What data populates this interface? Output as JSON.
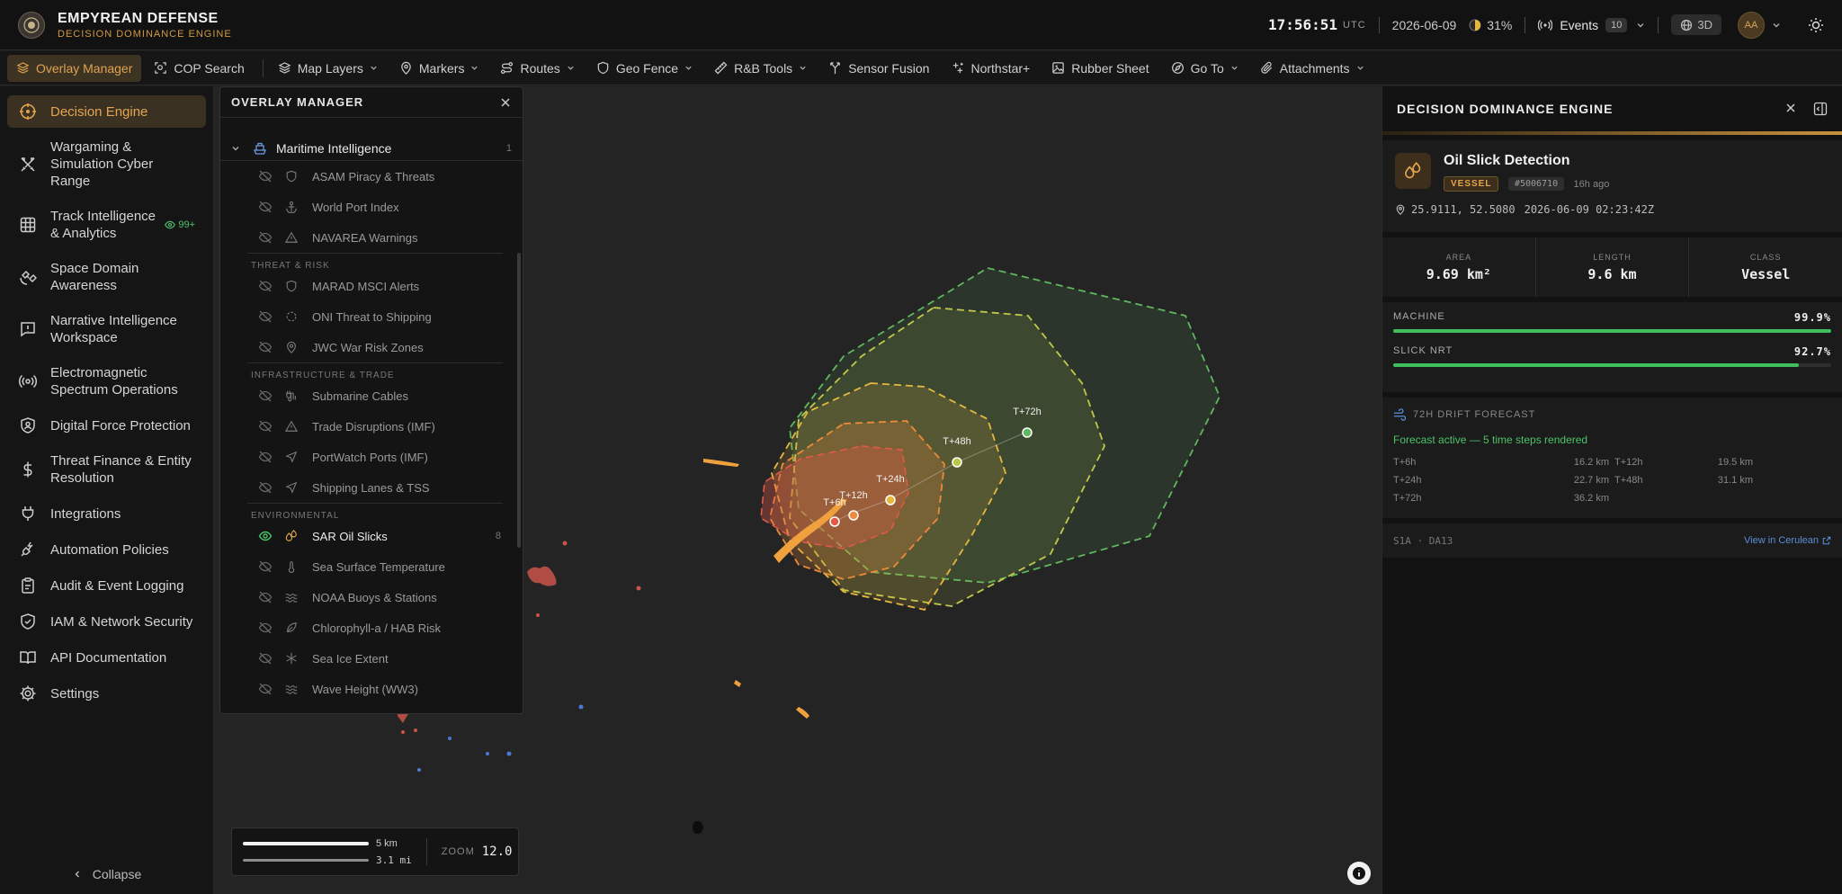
{
  "brand": {
    "title": "EMPYREAN DEFENSE",
    "subtitle": "DECISION DOMINANCE ENGINE"
  },
  "status": {
    "time": "17:56:51",
    "tz": "UTC",
    "date": "2026-06-09",
    "moon_pct": "31%",
    "events_label": "Events",
    "events_count": "10",
    "view_mode": "3D",
    "user_initials": "AA"
  },
  "toolbar": [
    {
      "label": "Overlay Manager",
      "icon": "layers-icon",
      "active": true
    },
    {
      "label": "COP Search",
      "icon": "scan-search-icon"
    },
    {
      "label": "Map Layers",
      "icon": "layers-icon",
      "chevron": true
    },
    {
      "label": "Markers",
      "icon": "map-pin-icon",
      "chevron": true
    },
    {
      "label": "Routes",
      "icon": "route-icon",
      "chevron": true
    },
    {
      "label": "Geo Fence",
      "icon": "shield-icon",
      "chevron": true
    },
    {
      "label": "R&B Tools",
      "icon": "ruler-icon",
      "chevron": true
    },
    {
      "label": "Sensor Fusion",
      "icon": "merge-icon"
    },
    {
      "label": "Northstar+",
      "icon": "sparkle-icon"
    },
    {
      "label": "Rubber Sheet",
      "icon": "image-icon"
    },
    {
      "label": "Go To",
      "icon": "compass-icon",
      "chevron": true
    },
    {
      "label": "Attachments",
      "icon": "paperclip-icon",
      "chevron": true
    }
  ],
  "sidebar": {
    "items": [
      {
        "label": "Decision Engine",
        "icon": "target-icon",
        "active": true
      },
      {
        "label": "Wargaming & Simulation Cyber Range",
        "icon": "swords-icon"
      },
      {
        "label": "Track Intelligence & Analytics",
        "icon": "grid-icon",
        "badge": "99+"
      },
      {
        "label": "Space Domain Awareness",
        "icon": "satellite-icon"
      },
      {
        "label": "Narrative Intelligence Workspace",
        "icon": "message-alert-icon"
      },
      {
        "label": "Electromagnetic Spectrum Operations",
        "icon": "radio-icon"
      },
      {
        "label": "Digital Force Protection",
        "icon": "shield-user-icon"
      },
      {
        "label": "Threat Finance & Entity Resolution",
        "icon": "dollar-icon"
      },
      {
        "label": "Integrations",
        "icon": "plug-icon"
      },
      {
        "label": "Automation Policies",
        "icon": "plug-zap-icon"
      },
      {
        "label": "Audit & Event Logging",
        "icon": "clipboard-icon"
      },
      {
        "label": "IAM & Network Security",
        "icon": "shield-check-icon"
      },
      {
        "label": "API Documentation",
        "icon": "book-icon"
      },
      {
        "label": "Settings",
        "icon": "gear-icon"
      }
    ],
    "collapse_label": "Collapse"
  },
  "overlay_manager": {
    "title": "OVERLAY MANAGER",
    "group": {
      "label": "Maritime Intelligence",
      "count": "1"
    },
    "rows_a": [
      {
        "label": "ASAM Piracy & Threats",
        "icon": "shield-icon"
      },
      {
        "label": "World Port Index",
        "icon": "anchor-icon"
      },
      {
        "label": "NAVAREA Warnings",
        "icon": "warning-icon"
      }
    ],
    "sec_threat": "THREAT & RISK",
    "rows_b": [
      {
        "label": "MARAD MSCI Alerts",
        "icon": "shield-icon"
      },
      {
        "label": "ONI Threat to Shipping",
        "icon": "crosshair-icon"
      },
      {
        "label": "JWC War Risk Zones",
        "icon": "map-pin-icon"
      }
    ],
    "sec_infra": "INFRASTRUCTURE & TRADE",
    "rows_c": [
      {
        "label": "Submarine Cables",
        "icon": "cable-icon"
      },
      {
        "label": "Trade Disruptions (IMF)",
        "icon": "warning-icon"
      },
      {
        "label": "PortWatch Ports (IMF)",
        "icon": "navigation-icon"
      },
      {
        "label": "Shipping Lanes & TSS",
        "icon": "navigation-icon"
      }
    ],
    "sec_env": "ENVIRONMENTAL",
    "rows_d": [
      {
        "label": "SAR Oil Slicks",
        "icon": "droplets-icon",
        "on": true,
        "count": "8"
      },
      {
        "label": "Sea Surface Temperature",
        "icon": "thermometer-icon"
      },
      {
        "label": "NOAA Buoys & Stations",
        "icon": "waves-icon"
      },
      {
        "label": "Chlorophyll-a / HAB Risk",
        "icon": "leaf-icon"
      },
      {
        "label": "Sea Ice Extent",
        "icon": "snowflake-icon"
      },
      {
        "label": "Wave Height (WW3)",
        "icon": "waves-icon"
      }
    ]
  },
  "map": {
    "markers": [
      "T+6h",
      "T+12h",
      "T+24h",
      "T+48h",
      "T+72h"
    ],
    "scale_km": "5 km",
    "scale_mi": "3.1 mi",
    "zoom_label": "ZOOM",
    "zoom_value": "12.0",
    "colors": {
      "t6": "#e05a4a",
      "t12": "#ee8a3a",
      "t24": "#e6b840",
      "t48": "#b5c84a",
      "t72": "#5fb75f",
      "slick": "#f0a03c"
    }
  },
  "panel": {
    "title": "DECISION DOMINANCE ENGINE",
    "detection": {
      "name": "Oil Slick Detection",
      "tag": "VESSEL",
      "id": "#5006710",
      "ago": "16h ago",
      "coords": "25.9111, 52.5080",
      "timestamp": "2026-06-09 02:23:42Z"
    },
    "stats": [
      {
        "label": "AREA",
        "value": "9.69 km²"
      },
      {
        "label": "LENGTH",
        "value": "9.6 km"
      },
      {
        "label": "CLASS",
        "value": "Vessel"
      }
    ],
    "confidence": [
      {
        "label": "MACHINE",
        "value": "99.9%",
        "pct": 99.9
      },
      {
        "label": "SLICK NRT",
        "value": "92.7%",
        "pct": 92.7
      }
    ],
    "forecast": {
      "title": "72H DRIFT FORECAST",
      "active": "Forecast active — 5 time steps rendered",
      "cells": [
        "T+6h",
        "16.2 km",
        "T+12h",
        "19.5 km",
        "T+24h",
        "22.7 km",
        "T+48h",
        "31.1 km",
        "T+72h",
        "36.2 km"
      ]
    },
    "source": {
      "text": "S1A · DA13",
      "link": "View in Cerulean"
    }
  }
}
